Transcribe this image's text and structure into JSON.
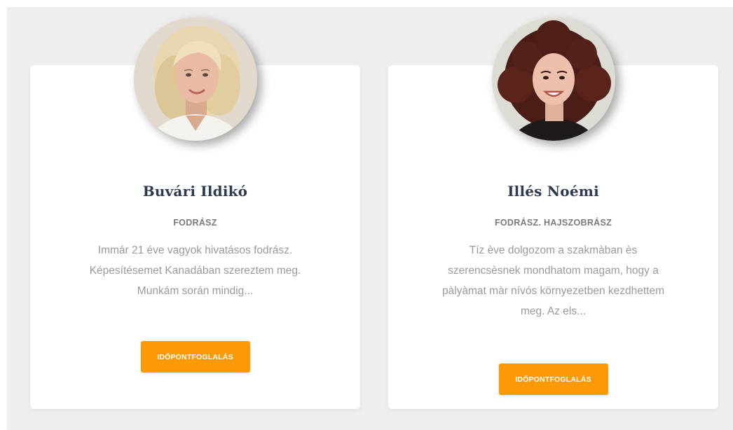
{
  "colors": {
    "background": "#eeeeee",
    "card": "#ffffff",
    "name": "#2d3a4f",
    "role": "#7a7a7a",
    "description": "#9a9a9a",
    "accent": "#fb9a06"
  },
  "cards": [
    {
      "photo": "portrait-blonde-woman",
      "name": "Buvári Ildikó",
      "role": "FODRÁSZ",
      "description_lines": [
        "Immár 21 éve vagyok hivatásos fodrász.",
        "Képesítésemet Kanadában szereztem meg.",
        "Munkám során mindig..."
      ],
      "button_label": "IDŐPONTFOGLALÁS"
    },
    {
      "photo": "portrait-curly-redhead-woman",
      "name": "Illés Noémi",
      "role": "FODRÁSZ. HAJSZOBRÁSZ",
      "description_lines": [
        "Tíz ève dolgozom a szakmàban ès",
        "szerencsèsnek mondhatom magam, hogy a",
        "pàlyàmat màr nívós környezetben kezdhettem",
        "meg. Az els..."
      ],
      "button_label": "IDŐPONTFOGLALÁS"
    }
  ]
}
